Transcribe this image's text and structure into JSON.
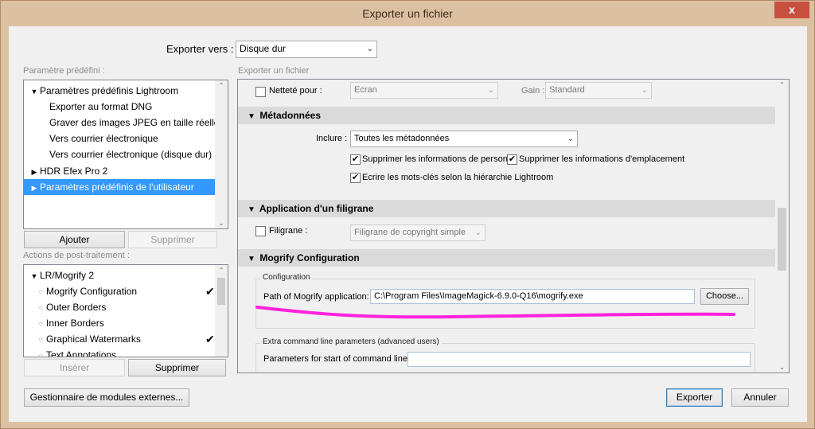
{
  "window": {
    "title": "Exporter un fichier",
    "close_glyph": "x"
  },
  "export_to": {
    "label": "Exporter vers :",
    "value": "Disque dur"
  },
  "presets": {
    "header": "Paramètre prédéfini :",
    "items": [
      {
        "label": "Paramètres prédéfinis Lightroom",
        "expander": "▼"
      },
      {
        "label": "Exporter au format DNG"
      },
      {
        "label": "Graver des images JPEG en taille réelle"
      },
      {
        "label": "Vers courrier électronique"
      },
      {
        "label": "Vers courrier électronique (disque dur)"
      },
      {
        "label": "HDR Efex Pro 2",
        "expander": "▶"
      },
      {
        "label": "Paramètres prédéfinis de l'utilisateur",
        "expander": "▶"
      }
    ],
    "add_button": "Ajouter",
    "remove_button": "Supprimer"
  },
  "post_actions": {
    "header": "Actions de post-traitement :",
    "items": [
      {
        "label": "LR/Mogrify 2",
        "expander": "▼",
        "check": ""
      },
      {
        "label": "Mogrify Configuration",
        "expander": "⁘",
        "check": "✔"
      },
      {
        "label": "Outer Borders",
        "expander": "⁘",
        "check": ""
      },
      {
        "label": "Inner Borders",
        "expander": "⁘",
        "check": ""
      },
      {
        "label": "Graphical Watermarks",
        "expander": "⁘",
        "check": "✔"
      },
      {
        "label": "Text Annotations",
        "expander": "⁘",
        "check": ""
      }
    ],
    "insert_button": "Insérer",
    "remove_button": "Supprimer"
  },
  "export_file": {
    "header": "Exporter un fichier",
    "sharpen": {
      "label": "Netteté pour :",
      "for_value": "Ecran",
      "amount_label": "Gain :",
      "amount_value": "Standard"
    },
    "metadata": {
      "title": "Métadonnées",
      "include_label": "Inclure :",
      "include_value": "Toutes les métadonnées",
      "remove_person": "Supprimer les informations de personne",
      "remove_location": "Supprimer les informations d'emplacement",
      "hierarchy": "Ecrire les mots-clés selon la hiérarchie Lightroom"
    },
    "watermark": {
      "title": "Application d'un filigrane",
      "label": "Filigrane :",
      "value": "Filigrane de copyright simple"
    },
    "mogrify": {
      "title": "Mogrify Configuration",
      "config_group": "Configuration",
      "path_label": "Path of Mogrify application:",
      "path_value": "C:\\Program Files\\ImageMagick-6.9.0-Q16\\mogrify.exe",
      "choose_button": "Choose...",
      "extra_group": "Extra command line parameters (advanced users)",
      "start_params_label": "Parameters for start of command line:",
      "start_params_value": ""
    }
  },
  "footer": {
    "plugin_manager_button": "Gestionnaire de modules externes...",
    "export_button": "Exporter",
    "cancel_button": "Annuler"
  },
  "colors": {
    "highlight": "#3399ff",
    "annotation": "#ff22dd",
    "titlebar": "#dcc0a2",
    "close": "#c7503f"
  }
}
